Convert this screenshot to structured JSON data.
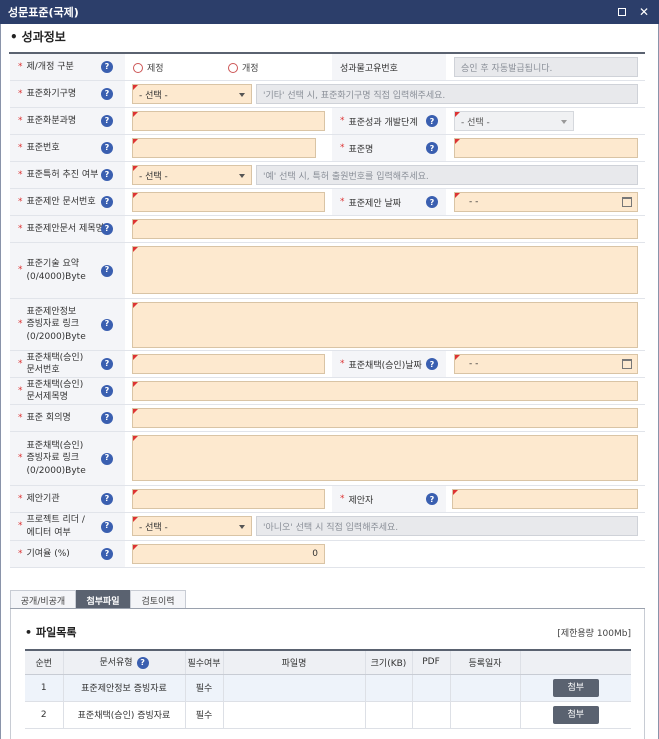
{
  "window": {
    "title": "성문표준(국제)",
    "maximize_label": "",
    "close_label": "✕"
  },
  "section": {
    "title": "성과정보"
  },
  "form": {
    "type_label": "제/개정 구분",
    "radio_enact": "제정",
    "radio_revise": "개정",
    "unique_no_label": "성과물고유번호",
    "unique_no_placeholder": "승인 후 자동발급됩니다.",
    "org_label": "표준화기구명",
    "select_default": "- 선택 -",
    "org_hint": "'기타' 선택 시, 표준화기구명 직접 입력해주세요.",
    "subcommittee_label": "표준화분과명",
    "stage_label": "표준성과 개발단계",
    "std_no_label": "표준번호",
    "std_name_label": "표준명",
    "patent_label": "표준특허 추진 여부",
    "patent_hint": "'예' 선택 시, 특허 출원번호를 입력해주세요.",
    "proposal_doc_no_label": "표준제안 문서번호",
    "proposal_date_label": "표준제안 날짜",
    "date_placeholder": "- -",
    "proposal_title_label": "표준제안문서 제목명",
    "summary_label": "표준기술 요약\n(0/4000)Byte",
    "proposal_link_label": "표준제안정보\n증빙자료 링크\n(0/2000)Byte",
    "adopt_doc_no_label": "표준채택(승인)\n문서번호",
    "adopt_date_label": "표준채택(승인)날짜",
    "adopt_title_label": "표준채택(승인)\n문서제목명",
    "meeting_label": "표준 회의명",
    "adopt_link_label": "표준채택(승인)\n증빙자료 링크\n(0/2000)Byte",
    "proposer_org_label": "제안기관",
    "proposer_label": "제안자",
    "leader_label": "프로젝트 리더 /\n에디터 여부",
    "leader_hint": "'아니오' 선택 시 직접 입력해주세요.",
    "contribution_label": "기여율 (%)",
    "contribution_value": "0",
    "help_icon": "?"
  },
  "tabs": [
    {
      "label": "공개/비공개"
    },
    {
      "label": "첨부파일"
    },
    {
      "label": "검토이력"
    }
  ],
  "files": {
    "title": "파일목록",
    "capacity": "[제한용량 100Mb]",
    "columns": [
      "순번",
      "문서유형",
      "필수여부",
      "파일명",
      "크기(KB)",
      "PDF",
      "등록일자",
      ""
    ],
    "rows": [
      {
        "no": "1",
        "type": "표준제안정보 증빙자료",
        "required": "필수",
        "file": "",
        "size": "",
        "pdf": "",
        "date": "",
        "button": "첨부"
      },
      {
        "no": "2",
        "type": "표준채택(승인) 증빙자료",
        "required": "필수",
        "file": "",
        "size": "",
        "pdf": "",
        "date": "",
        "button": "첨부"
      }
    ]
  },
  "colors": {
    "titlebar": "#2c3e6a",
    "required_field": "#fde9cf",
    "accent": "#3a5fb0",
    "tab_active": "#5a6270"
  }
}
